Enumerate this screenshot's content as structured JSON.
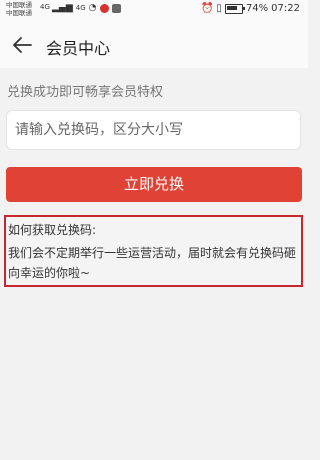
{
  "status_bar": {
    "carrier_1": "中国联通",
    "carrier_2": "中国联通",
    "signal_1": "4G",
    "signal_2": "4G",
    "battery": "74%",
    "time": "07:22",
    "icons": [
      "signal-icon",
      "wifi-icon",
      "app-notification-icon",
      "alarm-icon",
      "vibrate-icon",
      "battery-icon"
    ]
  },
  "header": {
    "title": "会员中心",
    "back_icon": "arrow-left-icon"
  },
  "main": {
    "subtitle": "兑换成功即可畅享会员特权",
    "code_input": {
      "placeholder": "请输入兑换码，区分大小写",
      "value": ""
    },
    "redeem_button": "立即兑换",
    "help": {
      "title": "如何获取兑换码:",
      "text": "我们会不定期举行一些运营活动，届时就会有兑换码砸向幸运的你啦~"
    }
  },
  "colors": {
    "accent": "#e04236",
    "highlight_border": "#c8262e"
  }
}
